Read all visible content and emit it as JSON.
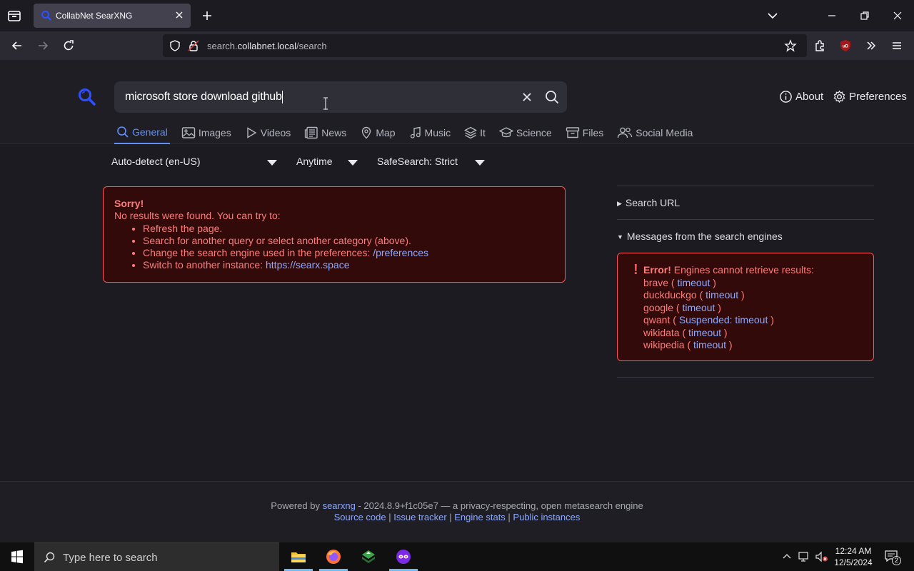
{
  "browser": {
    "tab": {
      "title": "CollabNet SearXNG"
    },
    "url": {
      "prefix": "search.",
      "domain": "collabnet.local",
      "path": "/search"
    }
  },
  "search": {
    "query": "microsoft store download github",
    "about_label": "About",
    "preferences_label": "Preferences"
  },
  "categories": [
    {
      "label": "General",
      "icon": "search-icon",
      "active": true
    },
    {
      "label": "Images",
      "icon": "image-icon"
    },
    {
      "label": "Videos",
      "icon": "play-icon"
    },
    {
      "label": "News",
      "icon": "newspaper-icon"
    },
    {
      "label": "Map",
      "icon": "map-pin-icon"
    },
    {
      "label": "Music",
      "icon": "music-note-icon"
    },
    {
      "label": "It",
      "icon": "layers-icon"
    },
    {
      "label": "Science",
      "icon": "school-icon"
    },
    {
      "label": "Files",
      "icon": "archive-icon"
    },
    {
      "label": "Social Media",
      "icon": "people-icon"
    }
  ],
  "filters": {
    "language": "Auto-detect (en-US)",
    "time": "Anytime",
    "safesearch": "SafeSearch: Strict"
  },
  "no_results": {
    "title": "Sorry!",
    "text": "No results were found. You can try to:",
    "item1": "Refresh the page.",
    "item2": "Search for another query or select another category (above).",
    "item3": "Change the search engine used in the preferences: ",
    "item3_link": "/preferences",
    "item4": "Switch to another instance: ",
    "item4_link": "https://searx.space"
  },
  "sidebar": {
    "search_url_label": "Search URL",
    "messages_label": "Messages from the search engines",
    "error_title": "Error!",
    "error_text": " Engines cannot retrieve results:",
    "engines": [
      {
        "name": "brave",
        "reason": "timeout"
      },
      {
        "name": "duckduckgo",
        "reason": "timeout"
      },
      {
        "name": "google",
        "reason": "timeout"
      },
      {
        "name": "qwant",
        "reason": "Suspended: timeout"
      },
      {
        "name": "wikidata",
        "reason": "timeout"
      },
      {
        "name": "wikipedia",
        "reason": "timeout"
      }
    ]
  },
  "footer": {
    "powered_by": "Powered by ",
    "searxng": "searxng",
    "version_text": " - 2024.8.9+f1c05e7 — a privacy-respecting, open metasearch engine",
    "source_code": "Source code",
    "issue_tracker": "Issue tracker",
    "engine_stats": "Engine stats",
    "public_instances": "Public instances",
    "separator": " | "
  },
  "taskbar": {
    "search_placeholder": "Type here to search",
    "time": "12:24 AM",
    "date": "12/5/2024",
    "notification_count": "2"
  },
  "colors": {
    "accent": "#5f8fff",
    "error": "#ff5252",
    "link": "#8ca8ff"
  }
}
